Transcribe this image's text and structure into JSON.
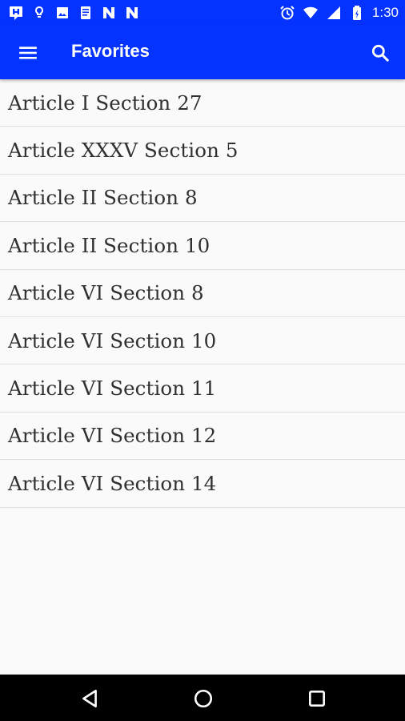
{
  "status_bar": {
    "time": "1:30",
    "left_icons": [
      "hangouts-icon",
      "lightbulb-icon",
      "image-icon",
      "document-icon",
      "n-app-icon",
      "n-app-icon"
    ],
    "right_icons": [
      "alarm-icon",
      "wifi-icon",
      "signal-icon",
      "battery-icon"
    ]
  },
  "app_bar": {
    "title": "Favorites",
    "menu_icon": "hamburger-menu-icon",
    "search_icon": "search-icon",
    "color": "#0433ff"
  },
  "favorites": [
    {
      "label": "Article I Section 27"
    },
    {
      "label": "Article XXXV Section 5"
    },
    {
      "label": "Article II Section 8"
    },
    {
      "label": "Article II Section 10"
    },
    {
      "label": "Article VI Section 8"
    },
    {
      "label": "Article VI Section 10"
    },
    {
      "label": "Article VI Section 11"
    },
    {
      "label": "Article VI Section 12"
    },
    {
      "label": "Article VI Section 14"
    }
  ],
  "nav_bar": {
    "buttons": [
      "back-icon",
      "home-icon",
      "recents-icon"
    ]
  }
}
